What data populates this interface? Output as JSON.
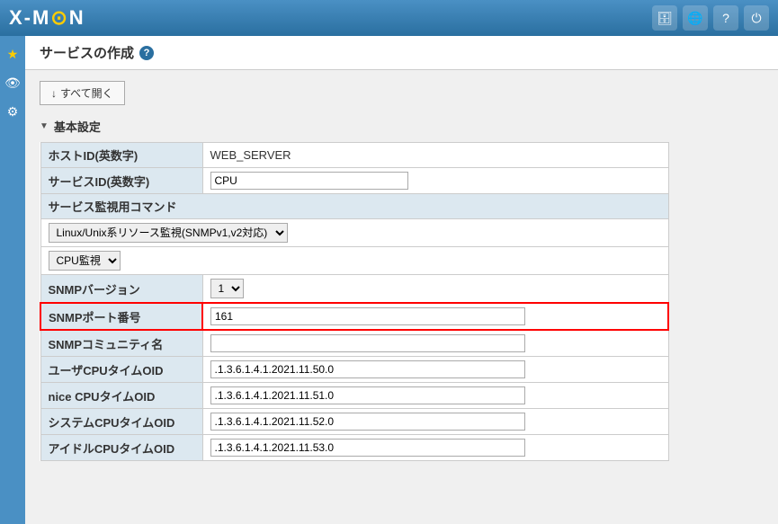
{
  "header": {
    "logo_x": "X-M",
    "logo_moon": "OON",
    "icons": [
      "database-icon",
      "globe-icon",
      "question-icon",
      "logout-icon"
    ]
  },
  "sidebar": {
    "items": [
      {
        "label": "★",
        "active": true
      },
      {
        "label": "👁",
        "active": false
      },
      {
        "label": "⚙",
        "active": false
      }
    ]
  },
  "page": {
    "title": "サービスの作成",
    "help_label": "?",
    "expand_button": "すべて開く",
    "expand_arrow": "↓"
  },
  "section": {
    "label": "基本設定",
    "triangle": "▼"
  },
  "form": {
    "host_id_label": "ホストID(英数字)",
    "host_id_value": "WEB_SERVER",
    "service_id_label": "サービスID(英数字)",
    "service_id_value": "CPU",
    "service_id_placeholder": "",
    "command_label": "サービス監視用コマンド",
    "command_select1_value": "Linux/Unix系リソース監視(SNMPv1,v2対応)",
    "command_select2_value": "CPU監視",
    "snmp_version_label": "SNMPバージョン",
    "snmp_version_value": "1",
    "snmp_port_label": "SNMPポート番号",
    "snmp_port_value": "161",
    "snmp_community_label": "SNMPコミュニティ名",
    "snmp_community_value": "",
    "user_cpu_label": "ユーザCPUタイムOID",
    "user_cpu_value": ".1.3.6.1.4.1.2021.11.50.0",
    "nice_cpu_label": "nice CPUタイムOID",
    "nice_cpu_value": ".1.3.6.1.4.1.2021.11.51.0",
    "system_cpu_label": "システムCPUタイムOID",
    "system_cpu_value": ".1.3.6.1.4.1.2021.11.52.0",
    "idle_cpu_label": "アイドルCPUタイムOID",
    "idle_cpu_value": ".1.3.6.1.4.1.2021.11.53.0"
  }
}
